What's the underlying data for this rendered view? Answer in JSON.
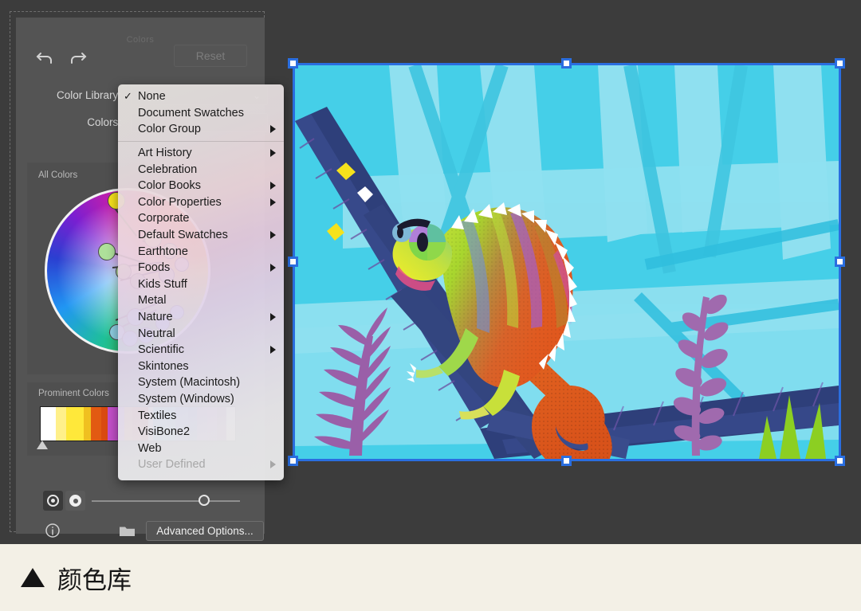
{
  "window": {
    "panel_title": "Colors",
    "background_color": "#3c3c3c",
    "panel_color": "#545454"
  },
  "toolbar": {
    "undo_icon": "undo-arrow-icon",
    "redo_icon": "redo-arrow-icon",
    "reset_label": "Reset",
    "reset_disabled": true
  },
  "fields": {
    "color_library_label": "Color Library:",
    "color_library_value": "None",
    "colors_label": "Colors:",
    "colors_value": ""
  },
  "wheel": {
    "label": "All Colors"
  },
  "prominent": {
    "label": "Prominent Colors",
    "swatches": [
      {
        "color": "#ffffff",
        "w": 14
      },
      {
        "color": "#fff08a",
        "w": 10
      },
      {
        "color": "#ffe83a",
        "w": 16
      },
      {
        "color": "#f0c020",
        "w": 7
      },
      {
        "color": "#e25a12",
        "w": 10
      },
      {
        "color": "#d94a10",
        "w": 6
      },
      {
        "color": "#c34fc9",
        "w": 9
      },
      {
        "color": "#a93fb5",
        "w": 6
      },
      {
        "color": "#e0661e",
        "w": 8
      },
      {
        "color": "#cf3f16",
        "w": 8
      },
      {
        "color": "#b92f10",
        "w": 7
      },
      {
        "color": "#e0d8cf",
        "w": 4
      },
      {
        "color": "#55cbe8",
        "w": 14
      },
      {
        "color": "#49b9e0",
        "w": 7
      },
      {
        "color": "#4f7fd0",
        "w": 12
      },
      {
        "color": "#4060c0",
        "w": 8
      },
      {
        "color": "#7a52b5",
        "w": 10
      },
      {
        "color": "#8f4aa8",
        "w": 9
      },
      {
        "color": "#7a3d88",
        "w": 9
      },
      {
        "color": "#d9d2c8",
        "w": 8
      }
    ]
  },
  "controls": {
    "toggle_a": "target-circle-icon",
    "toggle_b": "filled-circle-icon",
    "toggle_a_selected": true,
    "slider_value_pct": 76,
    "info_icon": "info-circle-icon",
    "folder_icon": "folder-icon",
    "advanced_label": "Advanced Options..."
  },
  "menu": {
    "groups": [
      {
        "items": [
          {
            "label": "None",
            "checked": true,
            "submenu": false,
            "disabled": false
          },
          {
            "label": "Document Swatches",
            "checked": false,
            "submenu": false,
            "disabled": false
          },
          {
            "label": "Color Group",
            "checked": false,
            "submenu": true,
            "disabled": false
          }
        ]
      },
      {
        "items": [
          {
            "label": "Art History",
            "checked": false,
            "submenu": true,
            "disabled": false
          },
          {
            "label": "Celebration",
            "checked": false,
            "submenu": false,
            "disabled": false
          },
          {
            "label": "Color Books",
            "checked": false,
            "submenu": true,
            "disabled": false
          },
          {
            "label": "Color Properties",
            "checked": false,
            "submenu": true,
            "disabled": false
          },
          {
            "label": "Corporate",
            "checked": false,
            "submenu": false,
            "disabled": false
          },
          {
            "label": "Default Swatches",
            "checked": false,
            "submenu": true,
            "disabled": false
          },
          {
            "label": "Earthtone",
            "checked": false,
            "submenu": false,
            "disabled": false
          },
          {
            "label": "Foods",
            "checked": false,
            "submenu": true,
            "disabled": false
          },
          {
            "label": "Kids Stuff",
            "checked": false,
            "submenu": false,
            "disabled": false
          },
          {
            "label": "Metal",
            "checked": false,
            "submenu": false,
            "disabled": false
          },
          {
            "label": "Nature",
            "checked": false,
            "submenu": true,
            "disabled": false
          },
          {
            "label": "Neutral",
            "checked": false,
            "submenu": false,
            "disabled": false
          },
          {
            "label": "Scientific",
            "checked": false,
            "submenu": true,
            "disabled": false
          },
          {
            "label": "Skintones",
            "checked": false,
            "submenu": false,
            "disabled": false
          },
          {
            "label": "System (Macintosh)",
            "checked": false,
            "submenu": false,
            "disabled": false
          },
          {
            "label": "System (Windows)",
            "checked": false,
            "submenu": false,
            "disabled": false
          },
          {
            "label": "Textiles",
            "checked": false,
            "submenu": false,
            "disabled": false
          },
          {
            "label": "VisiBone2",
            "checked": false,
            "submenu": false,
            "disabled": false
          },
          {
            "label": "Web",
            "checked": false,
            "submenu": false,
            "disabled": false
          },
          {
            "label": "User Defined",
            "checked": false,
            "submenu": true,
            "disabled": true
          }
        ]
      }
    ]
  },
  "artwork": {
    "description": "chameleon-illustration",
    "background_color": "#45cfe8",
    "selection_color": "#2a6ee0"
  },
  "caption": {
    "marker": "▲",
    "text": "颜色库"
  }
}
